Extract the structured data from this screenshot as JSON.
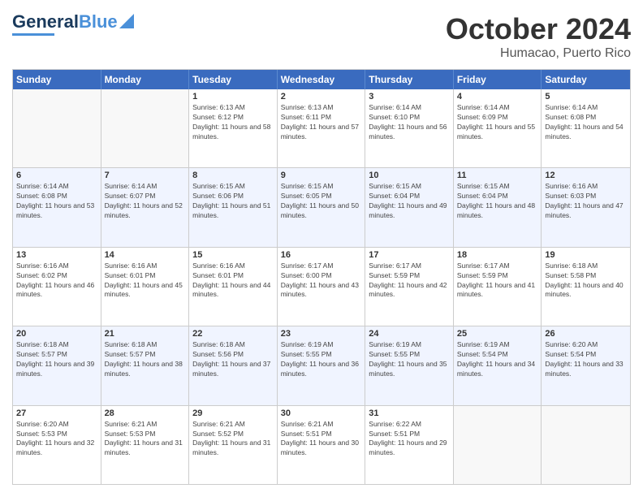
{
  "header": {
    "logo_line1": "General",
    "logo_line2": "Blue",
    "month": "October 2024",
    "location": "Humacao, Puerto Rico"
  },
  "weekdays": [
    "Sunday",
    "Monday",
    "Tuesday",
    "Wednesday",
    "Thursday",
    "Friday",
    "Saturday"
  ],
  "rows": [
    [
      {
        "day": "",
        "text": ""
      },
      {
        "day": "",
        "text": ""
      },
      {
        "day": "1",
        "text": "Sunrise: 6:13 AM\nSunset: 6:12 PM\nDaylight: 11 hours and 58 minutes."
      },
      {
        "day": "2",
        "text": "Sunrise: 6:13 AM\nSunset: 6:11 PM\nDaylight: 11 hours and 57 minutes."
      },
      {
        "day": "3",
        "text": "Sunrise: 6:14 AM\nSunset: 6:10 PM\nDaylight: 11 hours and 56 minutes."
      },
      {
        "day": "4",
        "text": "Sunrise: 6:14 AM\nSunset: 6:09 PM\nDaylight: 11 hours and 55 minutes."
      },
      {
        "day": "5",
        "text": "Sunrise: 6:14 AM\nSunset: 6:08 PM\nDaylight: 11 hours and 54 minutes."
      }
    ],
    [
      {
        "day": "6",
        "text": "Sunrise: 6:14 AM\nSunset: 6:08 PM\nDaylight: 11 hours and 53 minutes."
      },
      {
        "day": "7",
        "text": "Sunrise: 6:14 AM\nSunset: 6:07 PM\nDaylight: 11 hours and 52 minutes."
      },
      {
        "day": "8",
        "text": "Sunrise: 6:15 AM\nSunset: 6:06 PM\nDaylight: 11 hours and 51 minutes."
      },
      {
        "day": "9",
        "text": "Sunrise: 6:15 AM\nSunset: 6:05 PM\nDaylight: 11 hours and 50 minutes."
      },
      {
        "day": "10",
        "text": "Sunrise: 6:15 AM\nSunset: 6:04 PM\nDaylight: 11 hours and 49 minutes."
      },
      {
        "day": "11",
        "text": "Sunrise: 6:15 AM\nSunset: 6:04 PM\nDaylight: 11 hours and 48 minutes."
      },
      {
        "day": "12",
        "text": "Sunrise: 6:16 AM\nSunset: 6:03 PM\nDaylight: 11 hours and 47 minutes."
      }
    ],
    [
      {
        "day": "13",
        "text": "Sunrise: 6:16 AM\nSunset: 6:02 PM\nDaylight: 11 hours and 46 minutes."
      },
      {
        "day": "14",
        "text": "Sunrise: 6:16 AM\nSunset: 6:01 PM\nDaylight: 11 hours and 45 minutes."
      },
      {
        "day": "15",
        "text": "Sunrise: 6:16 AM\nSunset: 6:01 PM\nDaylight: 11 hours and 44 minutes."
      },
      {
        "day": "16",
        "text": "Sunrise: 6:17 AM\nSunset: 6:00 PM\nDaylight: 11 hours and 43 minutes."
      },
      {
        "day": "17",
        "text": "Sunrise: 6:17 AM\nSunset: 5:59 PM\nDaylight: 11 hours and 42 minutes."
      },
      {
        "day": "18",
        "text": "Sunrise: 6:17 AM\nSunset: 5:59 PM\nDaylight: 11 hours and 41 minutes."
      },
      {
        "day": "19",
        "text": "Sunrise: 6:18 AM\nSunset: 5:58 PM\nDaylight: 11 hours and 40 minutes."
      }
    ],
    [
      {
        "day": "20",
        "text": "Sunrise: 6:18 AM\nSunset: 5:57 PM\nDaylight: 11 hours and 39 minutes."
      },
      {
        "day": "21",
        "text": "Sunrise: 6:18 AM\nSunset: 5:57 PM\nDaylight: 11 hours and 38 minutes."
      },
      {
        "day": "22",
        "text": "Sunrise: 6:18 AM\nSunset: 5:56 PM\nDaylight: 11 hours and 37 minutes."
      },
      {
        "day": "23",
        "text": "Sunrise: 6:19 AM\nSunset: 5:55 PM\nDaylight: 11 hours and 36 minutes."
      },
      {
        "day": "24",
        "text": "Sunrise: 6:19 AM\nSunset: 5:55 PM\nDaylight: 11 hours and 35 minutes."
      },
      {
        "day": "25",
        "text": "Sunrise: 6:19 AM\nSunset: 5:54 PM\nDaylight: 11 hours and 34 minutes."
      },
      {
        "day": "26",
        "text": "Sunrise: 6:20 AM\nSunset: 5:54 PM\nDaylight: 11 hours and 33 minutes."
      }
    ],
    [
      {
        "day": "27",
        "text": "Sunrise: 6:20 AM\nSunset: 5:53 PM\nDaylight: 11 hours and 32 minutes."
      },
      {
        "day": "28",
        "text": "Sunrise: 6:21 AM\nSunset: 5:53 PM\nDaylight: 11 hours and 31 minutes."
      },
      {
        "day": "29",
        "text": "Sunrise: 6:21 AM\nSunset: 5:52 PM\nDaylight: 11 hours and 31 minutes."
      },
      {
        "day": "30",
        "text": "Sunrise: 6:21 AM\nSunset: 5:51 PM\nDaylight: 11 hours and 30 minutes."
      },
      {
        "day": "31",
        "text": "Sunrise: 6:22 AM\nSunset: 5:51 PM\nDaylight: 11 hours and 29 minutes."
      },
      {
        "day": "",
        "text": ""
      },
      {
        "day": "",
        "text": ""
      }
    ]
  ]
}
